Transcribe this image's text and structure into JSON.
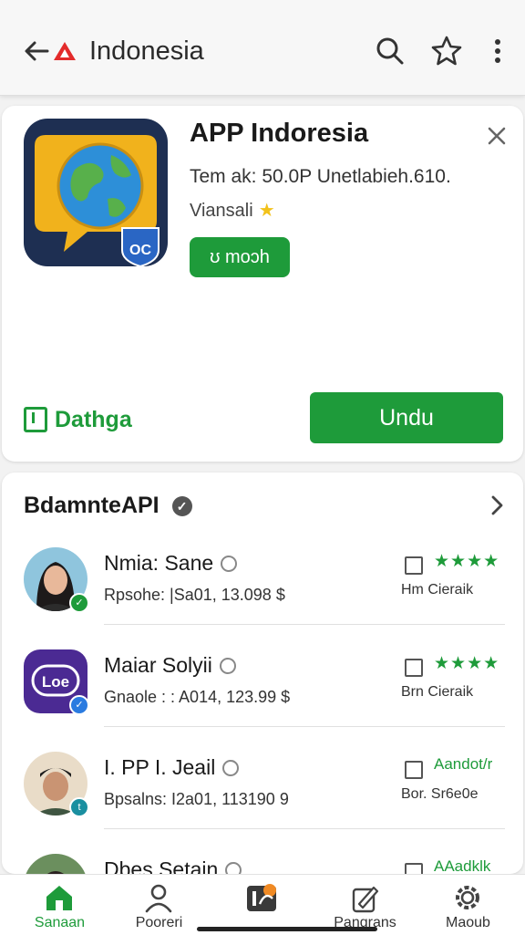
{
  "topbar": {
    "title": "Indonesia",
    "icons": [
      "back-arrow-icon",
      "brand-triangle-icon",
      "search-icon",
      "star-outline-icon",
      "more-vertical-icon"
    ]
  },
  "app": {
    "name": "APP Indoresia",
    "meta": "Tem ak: 50.0P Unetlabieh.610.",
    "rating_text": "Viansali",
    "rating_star": "★",
    "badge_icon_text": "OC",
    "pill_label": "ʊ moɔh",
    "details_label": "Dathga",
    "download_label": "Undu",
    "accent": "#1e9b3a"
  },
  "section": {
    "title": "BdamnteAPI",
    "verified_mark": "✓",
    "items": [
      {
        "name": "Nmia: Sane",
        "sub": "Rpsohe: |Sa01, 13.098 $",
        "rating_type": "stars",
        "rating": "★★★★",
        "rating_tag": "Hm Cierаik",
        "badge_color": "#1e9b3a",
        "badge_glyph": "✓"
      },
      {
        "name": "Maiar Solyii",
        "sub": "Gnaole : : A014, 123.99 $",
        "rating_type": "stars",
        "rating": "★★★★",
        "rating_tag": "Brn Cierаik",
        "avatar_text": "Loe",
        "badge_color": "#2a7be0",
        "badge_glyph": "✓"
      },
      {
        "name": "I. PP I. Jeail",
        "sub": "Bpsalns: I2a01, 113190 9",
        "rating_type": "text",
        "rating": "Aandot/r",
        "rating_tag": "Bor. Sr6e0e",
        "badge_color": "#1a8fa0",
        "badge_glyph": "t"
      },
      {
        "name": "Dbes Setain",
        "sub": "",
        "rating_type": "text",
        "rating": "AAadklk",
        "rating_tag": "",
        "badge_color": "#1e9b3a",
        "badge_glyph": ""
      }
    ]
  },
  "bottom_nav": [
    {
      "label": "Sanaan",
      "icon": "home-icon",
      "active": true
    },
    {
      "label": "Pooreri",
      "icon": "person-icon",
      "active": false
    },
    {
      "label": "",
      "icon": "apps-icon",
      "active": false
    },
    {
      "label": "Pangrans",
      "icon": "edit-icon",
      "active": false
    },
    {
      "label": "Maoub",
      "icon": "gear-icon",
      "active": false
    }
  ]
}
